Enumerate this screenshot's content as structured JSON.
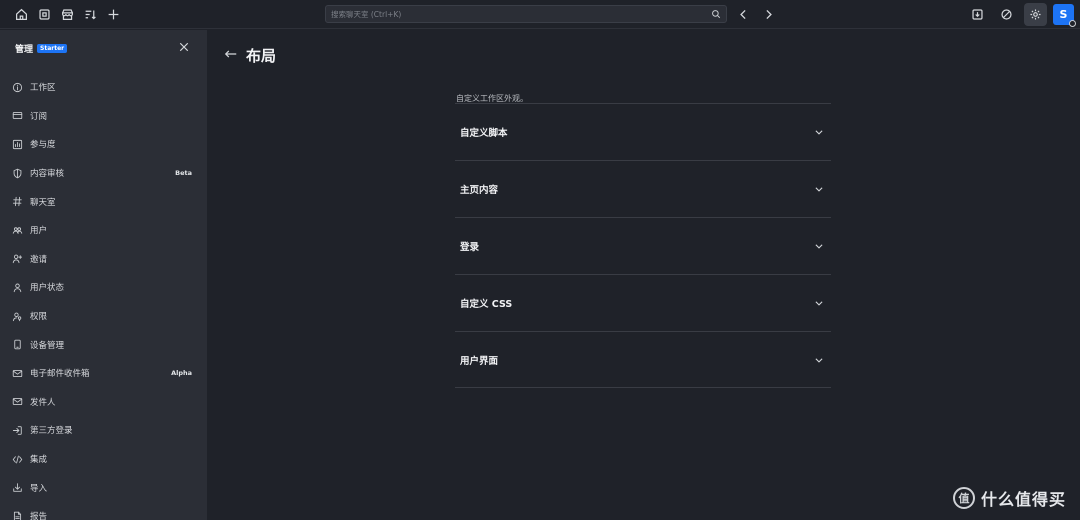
{
  "topbar": {
    "search_placeholder": "搜索聊天室 (Ctrl+K)",
    "avatar_letter": "S"
  },
  "sidebar": {
    "title": "管理",
    "plan_badge": "Starter",
    "items": [
      {
        "label": "工作区",
        "icon": "info-icon",
        "tag": ""
      },
      {
        "label": "订阅",
        "icon": "card-icon",
        "tag": ""
      },
      {
        "label": "参与度",
        "icon": "bar-chart-icon",
        "tag": ""
      },
      {
        "label": "内容审核",
        "icon": "shield-icon",
        "tag": "Beta"
      },
      {
        "label": "聊天室",
        "icon": "hashtag-icon",
        "tag": ""
      },
      {
        "label": "用户",
        "icon": "team-icon",
        "tag": ""
      },
      {
        "label": "邀请",
        "icon": "user-plus-icon",
        "tag": ""
      },
      {
        "label": "用户状态",
        "icon": "user-icon",
        "tag": ""
      },
      {
        "label": "权限",
        "icon": "user-key-icon",
        "tag": ""
      },
      {
        "label": "设备管理",
        "icon": "mobile-icon",
        "tag": ""
      },
      {
        "label": "电子邮件收件箱",
        "icon": "mail-icon",
        "tag": "Alpha"
      },
      {
        "label": "发件人",
        "icon": "mail-icon",
        "tag": ""
      },
      {
        "label": "第三方登录",
        "icon": "login-icon",
        "tag": ""
      },
      {
        "label": "集成",
        "icon": "code-icon",
        "tag": ""
      },
      {
        "label": "导入",
        "icon": "download-icon",
        "tag": ""
      },
      {
        "label": "报告",
        "icon": "file-icon",
        "tag": ""
      }
    ]
  },
  "main": {
    "title": "布局",
    "description": "自定义工作区外观。",
    "sections": [
      {
        "label": "自定义脚本"
      },
      {
        "label": "主页内容"
      },
      {
        "label": "登录"
      },
      {
        "label": "自定义 CSS"
      },
      {
        "label": "用户界面"
      }
    ]
  },
  "watermark": {
    "logo_char": "值",
    "text": "什么值得买"
  },
  "colors": {
    "background": "#1f2229",
    "sidebar": "#2b2e36",
    "accent": "#1d74f5"
  }
}
